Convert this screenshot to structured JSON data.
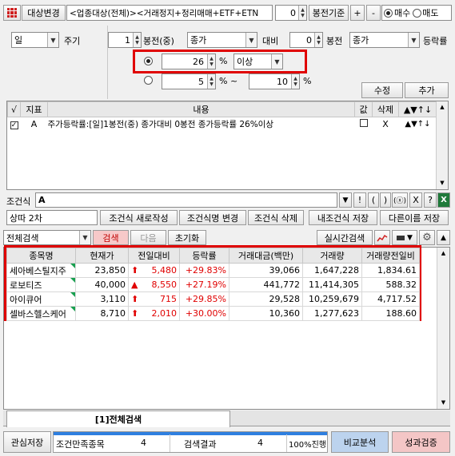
{
  "toolbar": {
    "target_change": "대상변경",
    "target_desc": "<업종대상(전체)><거래정지+정리매매+ETF+ETN",
    "bong_value": "0",
    "bong_base": "봉전기준",
    "plus": "+",
    "minus": "-",
    "buy": "매수",
    "sell": "매도"
  },
  "period": {
    "label": "일",
    "cycle": "주기"
  },
  "compare": {
    "left_value": "1",
    "left_suffix": "봉전(중)",
    "left_price": "종가",
    "vs": "대비",
    "right_value": "0",
    "right_suffix": "봉전",
    "right_price": "종가",
    "rate": "등락률"
  },
  "option1": {
    "value": "26",
    "unit": "%",
    "cond": "이상"
  },
  "option2": {
    "from": "5",
    "unit1": "% ~",
    "to": "10",
    "unit2": "%"
  },
  "actions": {
    "edit": "수정",
    "add": "추가"
  },
  "cond_table": {
    "headers": [
      "√",
      "지표",
      "내용",
      "값",
      "삭제",
      "▲▼↑↓"
    ],
    "rows": [
      {
        "id": "A",
        "content": "주가등락률:[일]1봉전(중) 종가대비 0봉전 종가등락률 26%이상",
        "del": "X",
        "move": "▲▼↑↓"
      }
    ]
  },
  "formula": {
    "label": "조건식",
    "value": "A",
    "buttons": [
      "!",
      "(",
      ")",
      "(ⓧ)",
      "X",
      "?"
    ]
  },
  "strategy": {
    "name": "상따 2차",
    "new": "조건식 새로작성",
    "rename": "조건식명 변경",
    "delete": "조건식 삭제",
    "save": "내조건식 저장",
    "save_as": "다른이름 저장"
  },
  "search": {
    "mode": "전체검색",
    "search": "검색",
    "next": "다음",
    "reset": "초기화",
    "realtime": "실시간검색"
  },
  "results": {
    "headers": [
      "종목명",
      "현재가",
      "전일대비",
      "등락률",
      "거래대금(백만)",
      "거래량",
      "거래량전일비"
    ],
    "rows": [
      {
        "name": "세아베스틸지주",
        "price": "23,850",
        "arrow": "⬆",
        "change": "5,480",
        "rate": "+29.83%",
        "amount": "39,066",
        "volume": "1,647,228",
        "ratio": "1,834.61"
      },
      {
        "name": "로보티즈",
        "price": "40,000",
        "arrow": "▲",
        "change": "8,550",
        "rate": "+27.19%",
        "amount": "441,772",
        "volume": "11,414,305",
        "ratio": "588.32"
      },
      {
        "name": "아이큐어",
        "price": "3,110",
        "arrow": "⬆",
        "change": "715",
        "rate": "+29.85%",
        "amount": "29,528",
        "volume": "10,259,679",
        "ratio": "4,717.52"
      },
      {
        "name": "셀바스헬스케어",
        "price": "8,710",
        "arrow": "⬆",
        "change": "2,010",
        "rate": "+30.00%",
        "amount": "10,360",
        "volume": "1,277,623",
        "ratio": "188.60"
      }
    ]
  },
  "tab": {
    "label": "[1]전체검색"
  },
  "footer": {
    "watch_save": "관심저장",
    "cond_count_label": "조건만족종목",
    "cond_count": "4",
    "result_label": "검색결과",
    "result_count": "4",
    "progress": "100%진행",
    "progress_fraction": 1.0,
    "compare": "비교분석",
    "verify": "성과검증"
  },
  "colors": {
    "accent_red": "#e00000",
    "progress_blue": "#2f7fe0",
    "compare_bg": "#bcd3ee",
    "verify_bg": "#f4c6c6"
  }
}
